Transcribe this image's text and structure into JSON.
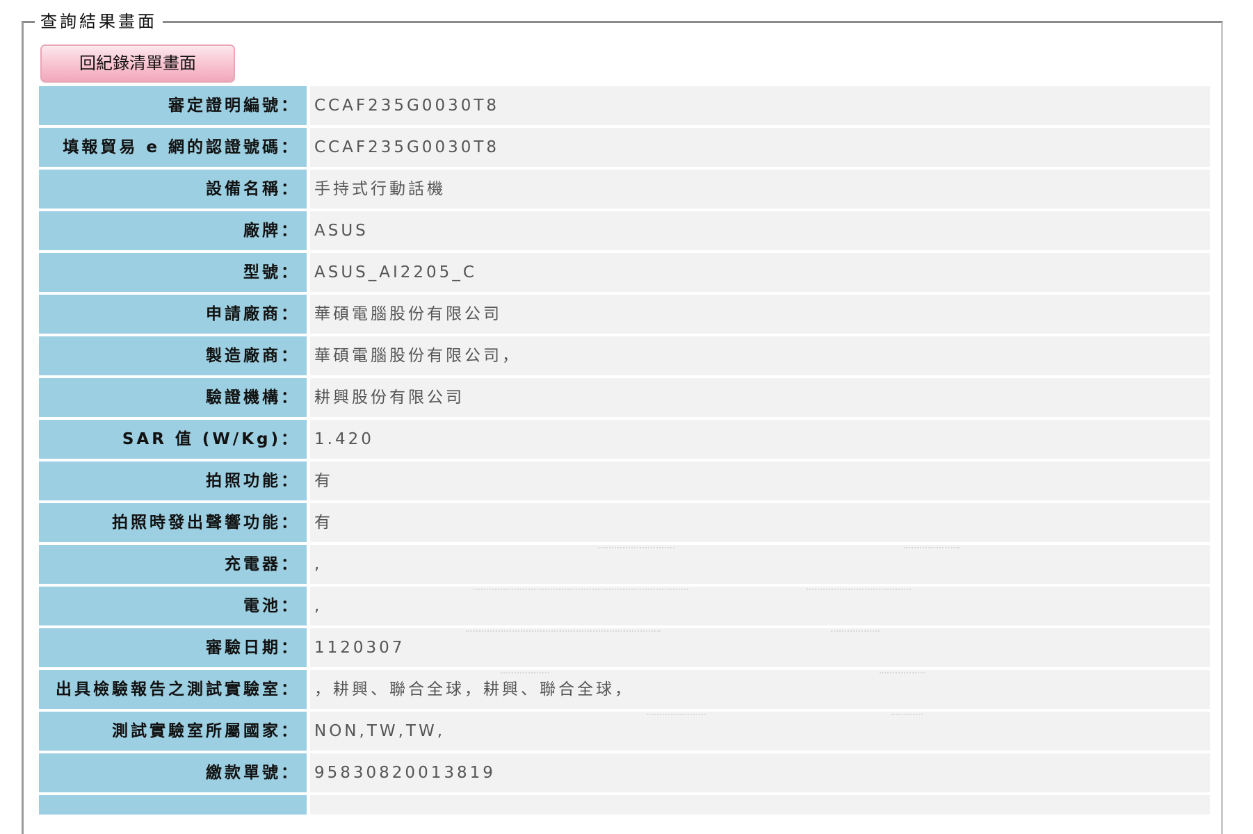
{
  "section": {
    "legend": "查詢結果畫面",
    "back_button": "回紀錄清單畫面"
  },
  "records": [
    {
      "label": "審定證明編號：",
      "value": "CCAF235G0030T8"
    },
    {
      "label": "填報貿易 e 網的認證號碼：",
      "value": "CCAF235G0030T8"
    },
    {
      "label": "設備名稱：",
      "value": "手持式行動話機"
    },
    {
      "label": "廠牌：",
      "value": "ASUS"
    },
    {
      "label": "型號：",
      "value": "ASUS_AI2205_C"
    },
    {
      "label": "申請廠商：",
      "value": "華碩電腦股份有限公司"
    },
    {
      "label": "製造廠商：",
      "value": "華碩電腦股份有限公司，"
    },
    {
      "label": "驗證機構：",
      "value": "耕興股份有限公司"
    },
    {
      "label": "SAR 值 (W/Kg)：",
      "value": "1.420"
    },
    {
      "label": "拍照功能：",
      "value": "有"
    },
    {
      "label": "拍照時發出聲響功能：",
      "value": "有"
    },
    {
      "label": "充電器：",
      "value": ","
    },
    {
      "label": "電池：",
      "value": ","
    },
    {
      "label": "審驗日期：",
      "value": "1120307"
    },
    {
      "label": "出具檢驗報告之測試實驗室：",
      "value": "，耕興、聯合全球，耕興、聯合全球，"
    },
    {
      "label": "測試實驗室所屬國家：",
      "value": "NON,TW,TW,"
    },
    {
      "label": "繳款單號：",
      "value": "95830820013819"
    },
    {
      "label": "",
      "value": ""
    }
  ]
}
